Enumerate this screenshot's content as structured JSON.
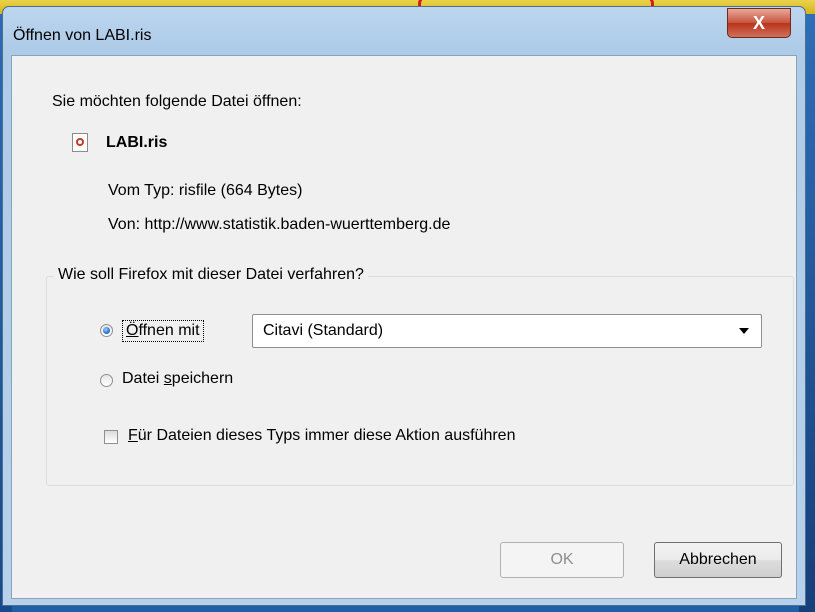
{
  "dialog": {
    "title": "Öffnen von LABI.ris",
    "close_label": "X",
    "prompt": "Sie möchten folgende Datei öffnen:",
    "file_name": "LABI.ris",
    "type_text": "Vom Typ: risfile (664 Bytes)",
    "from_text": "Von: http://www.statistik.baden-wuerttemberg.de"
  },
  "group": {
    "legend": "Wie soll Firefox mit dieser Datei verfahren?",
    "open_with": {
      "selected": true,
      "label_first": "Ö",
      "label_rest": "ffnen mit"
    },
    "app_select": {
      "value": "Citavi (Standard)"
    },
    "save_file": {
      "selected": false,
      "label_pre": "Datei ",
      "label_accel": "s",
      "label_post": "peichern"
    },
    "always": {
      "checked": false,
      "label_accel": "F",
      "label_rest": "ür Dateien dieses Typs immer diese Aktion ausführen"
    }
  },
  "buttons": {
    "ok": "OK",
    "cancel": "Abbrechen"
  },
  "colors": {
    "close_button": "#c7533b",
    "highlight_border": "#d81b1b"
  }
}
